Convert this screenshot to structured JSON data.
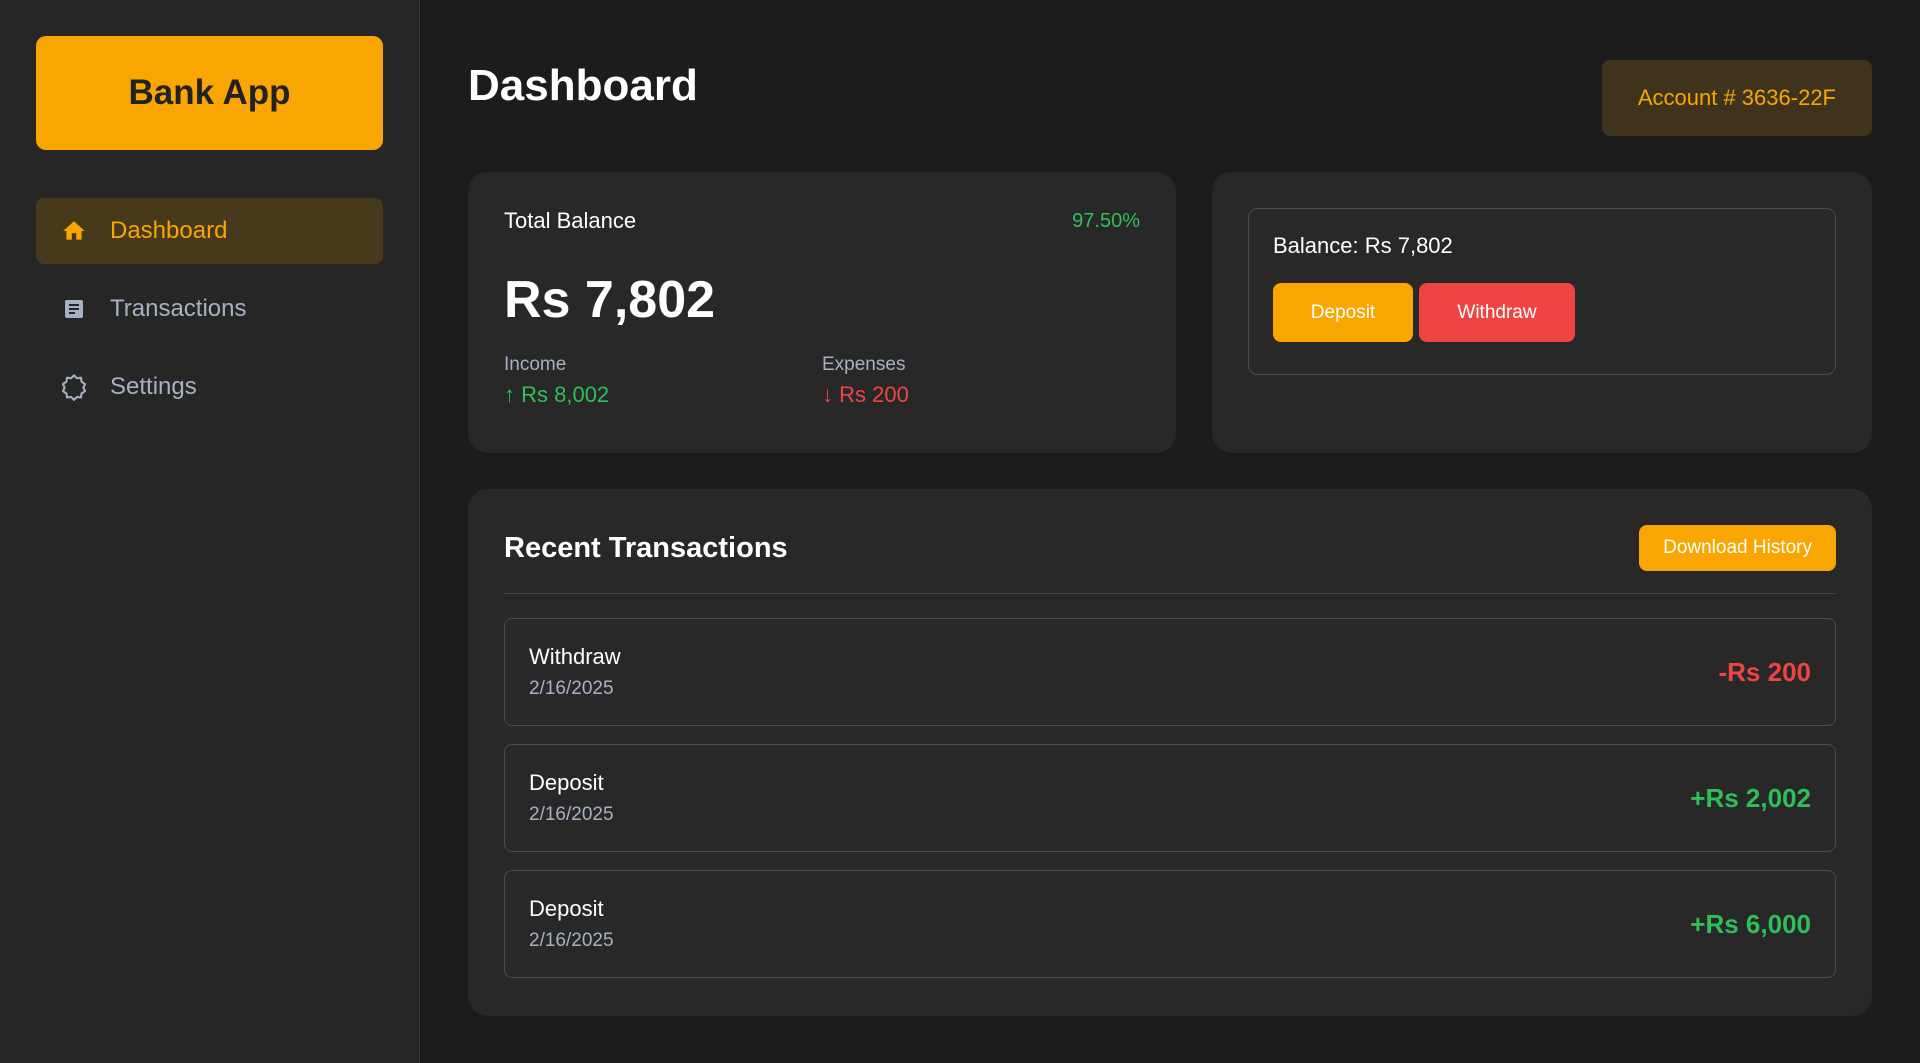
{
  "sidebar": {
    "logo": "Bank App",
    "items": [
      {
        "label": "Dashboard",
        "icon": "home-icon",
        "active": true
      },
      {
        "label": "Transactions",
        "icon": "document-icon",
        "active": false
      },
      {
        "label": "Settings",
        "icon": "gear-icon",
        "active": false
      }
    ]
  },
  "header": {
    "title": "Dashboard",
    "account": "Account # 3636-22F"
  },
  "balance_card": {
    "label": "Total Balance",
    "percent": "97.50%",
    "amount": "Rs 7,802",
    "income_label": "Income",
    "income_value": "↑ Rs 8,002",
    "expenses_label": "Expenses",
    "expenses_value": "↓ Rs 200"
  },
  "action_card": {
    "balance": "Balance: Rs 7,802",
    "deposit_label": "Deposit",
    "withdraw_label": "Withdraw"
  },
  "transactions": {
    "title": "Recent Transactions",
    "download_label": "Download History",
    "items": [
      {
        "name": "Withdraw",
        "date": "2/16/2025",
        "amount": "-Rs 200"
      },
      {
        "name": "Deposit",
        "date": "2/16/2025",
        "amount": "+Rs 2,002"
      },
      {
        "name": "Deposit",
        "date": "2/16/2025",
        "amount": "+Rs 6,000"
      }
    ]
  },
  "colors": {
    "accent": "#f9a602",
    "positive": "#2fbf59",
    "negative": "#ef4444",
    "background": "#1c1c1c",
    "card": "#282828"
  }
}
